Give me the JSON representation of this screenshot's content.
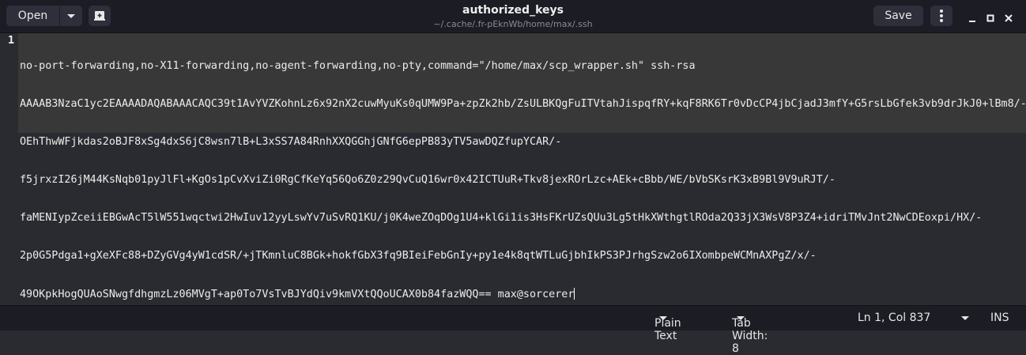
{
  "header": {
    "open_label": "Open",
    "title": "authorized_keys",
    "subtitle": "~/.cache/.fr-pEknWb/home/max/.ssh",
    "save_label": "Save"
  },
  "editor": {
    "line_number": "1",
    "lines": [
      "no-port-forwarding,no-X11-forwarding,no-agent-forwarding,no-pty,command=\"/home/max/scp_wrapper.sh\" ssh-rsa",
      "AAAAB3NzaC1yc2EAAAADAQABAAACAQC39t1AvYVZKohnLz6x92nX2cuwMyuKs0qUMW9Pa+zpZk2hb/ZsULBKQgFuITVtahJispqfRY+kqF8RK6Tr0vDcCP4jbCjadJ3mfY+G5rsLbGfek3vb9drJkJ0+lBm8/-",
      "OEhThwWFjkdas2oBJF8xSg4dxS6jC8wsn7lB+L3xSS7A84RnhXXQGGhjGNfG6epPB83yTV5awDQZfupYCAR/-",
      "f5jrxzI26jM44KsNqb01pyJlFl+KgOs1pCvXviZi0RgCfKeYq56Qo6Z0z29QvCuQ16wr0x42ICTUuR+Tkv8jexROrLzc+AEk+cBbb/WE/bVbSKsrK3xB9Bl9V9uRJT/-",
      "faMENIypZceiiEBGwAcT5lW551wqctwi2HwIuv12yyLswYv7uSvRQ1KU/j0K4weZOqDOg1U4+klGi1is3HsFKrUZsQUu3Lg5tHkXWthgtlROda2Q33jX3WsV8P3Z4+idriTMvJnt2NwCDEoxpi/HX/-",
      "2p0G5Pdga1+gXeXFc88+DZyGVg4yW1cdSR/+jTKmnluC8BGk+hokfGbX3fq9BIeiFebGnIy+py1e4k8qtWTLuGjbhIkPS3PJrhgSzw2o6IXombpeWCMnAXPgZ/x/-",
      "49OKpkHogQUAoSNwgfdhgmzLz06MVgT+ap0To7VsTvBJYdQiv9kmVXtQQoUCAX0b84fazWQQ== max@sorcerer"
    ]
  },
  "status": {
    "language": "Plain Text",
    "tab_width": "Tab Width: 8",
    "position": "Ln 1, Col 837",
    "mode": "INS"
  }
}
